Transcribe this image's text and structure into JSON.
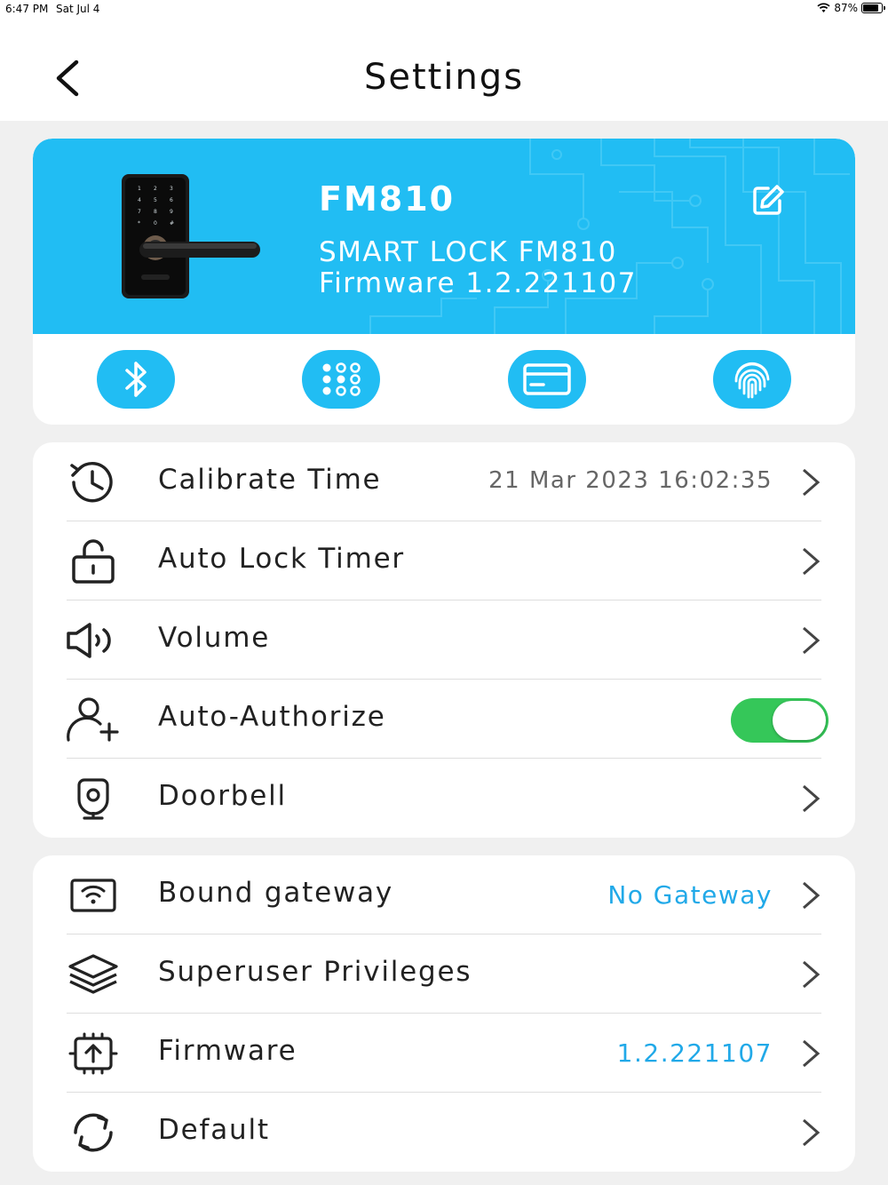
{
  "status_bar": {
    "time": "6:47 PM",
    "date": "Sat Jul 4",
    "battery": "87%",
    "battery_level": 0.87
  },
  "header": {
    "title": "Settings",
    "back_icon": "chevron-left-icon"
  },
  "device": {
    "name": "FM810",
    "model": "SMART LOCK FM810",
    "firmware": "Firmware 1.2.221107",
    "banner_color": "#21bdf3",
    "edit_icon": "edit-icon"
  },
  "functions": [
    {
      "name": "bluetooth",
      "icon": "bluetooth-icon"
    },
    {
      "name": "password",
      "icon": "keypad-icon"
    },
    {
      "name": "card",
      "icon": "card-icon"
    },
    {
      "name": "fingerprint",
      "icon": "fingerprint-icon"
    }
  ],
  "settings_group_1": [
    {
      "label": "Calibrate Time",
      "value": "21 Mar 2023 16:02:35",
      "icon": "clock-icon"
    },
    {
      "label": "Auto Lock Timer",
      "value": "",
      "icon": "unlock-icon"
    },
    {
      "label": "Volume",
      "value": "",
      "icon": "speaker-icon"
    },
    {
      "label": "Auto-Authorize",
      "toggle": true,
      "icon": "add-user-icon"
    },
    {
      "label": "Doorbell",
      "value": "",
      "icon": "doorbell-icon"
    }
  ],
  "settings_group_2": [
    {
      "label": "Bound gateway",
      "value": "No Gateway",
      "icon": "gateway-icon"
    },
    {
      "label": "Superuser Privileges",
      "value": "",
      "icon": "layers-icon"
    },
    {
      "label": "Firmware",
      "value": "1.2.221107",
      "icon": "firmware-upgrade-icon"
    },
    {
      "label": "Default",
      "value": "",
      "icon": "reset-icon"
    }
  ],
  "colors": {
    "accent": "#21bdf3",
    "toggle_on": "#35c759",
    "value_blue": "#21a9e8"
  }
}
